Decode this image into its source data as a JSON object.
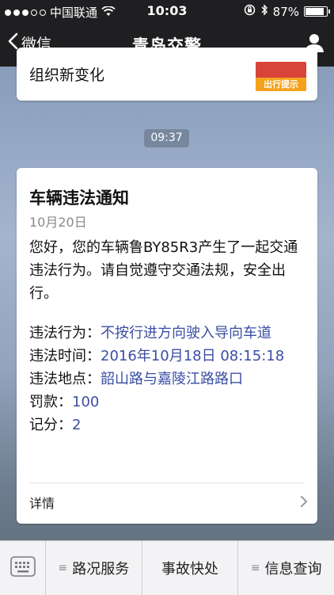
{
  "status_bar": {
    "carrier": "中国联通",
    "time": "10:03",
    "battery_percent": "87%",
    "battery_level": 0.87
  },
  "nav_bar": {
    "back_label": "微信",
    "title": "青岛交警"
  },
  "previous_message": {
    "text": "组织新变化",
    "thumbnail_label": "出行提示"
  },
  "timestamp": "09:37",
  "notice_card": {
    "title": "车辆违法通知",
    "date": "10月20日",
    "intro": "您好，您的车辆鲁BY85R3产生了一起交通违法行为。请自觉遵守交通法规，安全出行。",
    "rows": [
      {
        "label": "违法行为：",
        "value": "不按行进方向驶入导向车道"
      },
      {
        "label": "违法时间：",
        "value": "2016年10月18日 08:15:18"
      },
      {
        "label": "违法地点：",
        "value": "韶山路与嘉陵江路路口"
      },
      {
        "label": "罚款：",
        "value": "100"
      },
      {
        "label": "记分：",
        "value": "2"
      }
    ],
    "details_label": "详情"
  },
  "bottom_menu": {
    "items": [
      "路况服务",
      "事故快处",
      "信息查询"
    ]
  },
  "colors": {
    "bar_background": "#1f1f22",
    "value_link": "#3a4ea3",
    "date_gray": "#8a8a8a"
  }
}
